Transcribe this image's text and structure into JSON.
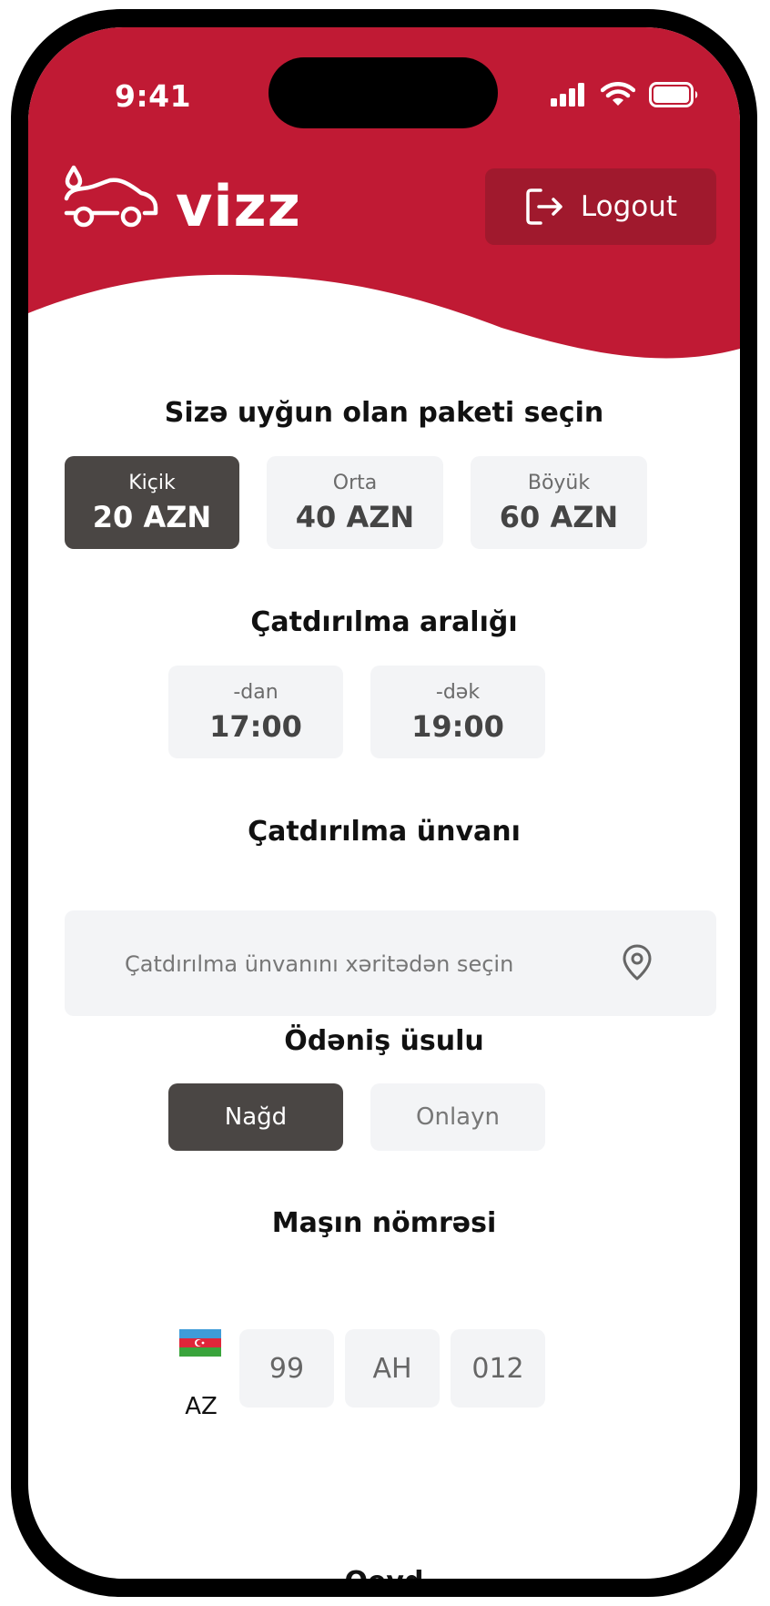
{
  "status_bar": {
    "time": "9:41",
    "signal_icon": "cellular-signal-icon",
    "wifi_icon": "wifi-icon",
    "battery_icon": "battery-icon"
  },
  "header": {
    "brand_color": "#c01a34",
    "logo_icon": "car-water-drop-icon",
    "logo_text": "vizz",
    "logout_icon": "logout-icon",
    "logout_label": "Logout"
  },
  "package": {
    "title": "Sizə uyğun olan paketi seçin",
    "options": [
      {
        "name": "Kiçik",
        "price": "20 AZN",
        "selected": true
      },
      {
        "name": "Orta",
        "price": "40 AZN",
        "selected": false
      },
      {
        "name": "Böyük",
        "price": "60 AZN",
        "selected": false
      }
    ]
  },
  "delivery_range": {
    "title": "Çatdırılma aralığı",
    "from": {
      "label": "-dan",
      "value": "17:00"
    },
    "to": {
      "label": "-dək",
      "value": "19:00"
    }
  },
  "delivery_address": {
    "title": "Çatdırılma ünvanı",
    "placeholder": "Çatdırılma ünvanını xəritədən seçin",
    "icon": "location-pin-icon"
  },
  "payment": {
    "title": "Ödəniş üsulu",
    "options": [
      {
        "label": "Nağd",
        "selected": true
      },
      {
        "label": "Onlayn",
        "selected": false
      }
    ]
  },
  "car_number": {
    "title": "Maşın nömrəsi",
    "flag_icon": "azerbaijan-flag-icon",
    "country": "AZ",
    "parts": [
      "99",
      "AH",
      "012"
    ]
  },
  "next_section": {
    "title": "Qeyd"
  },
  "colors": {
    "selected": "#4a4644",
    "tile": "#f3f4f6"
  }
}
